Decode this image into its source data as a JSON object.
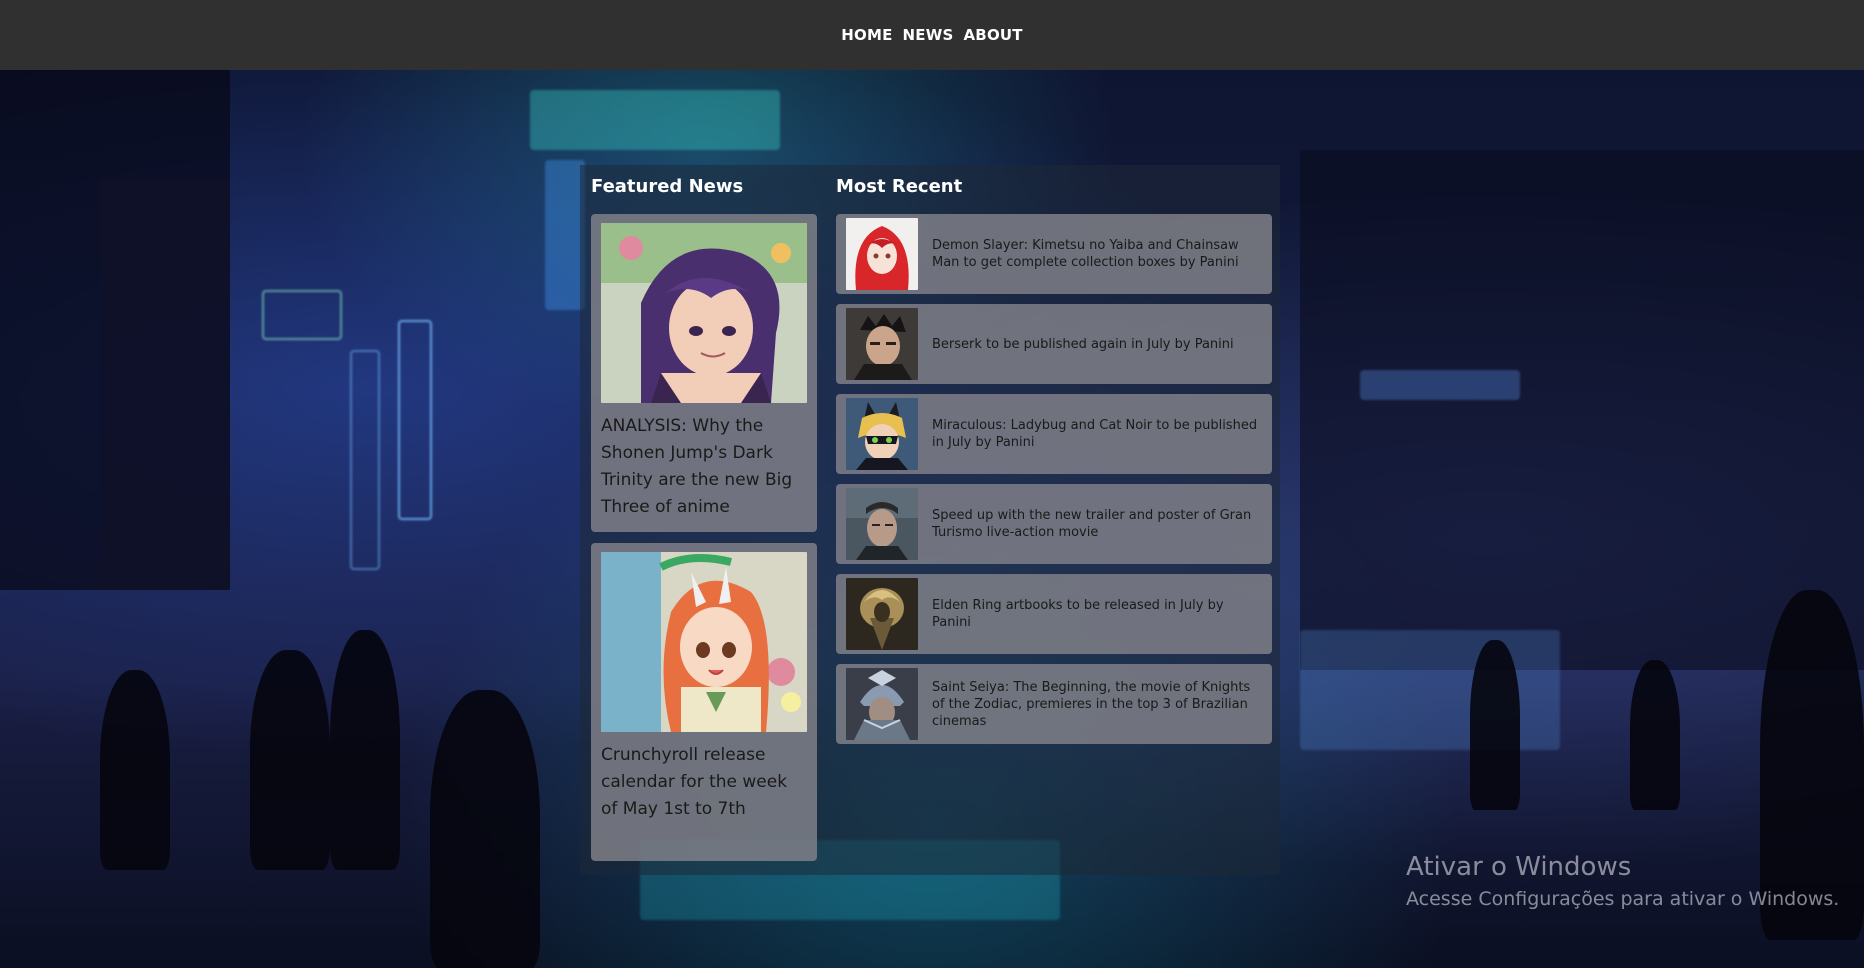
{
  "nav": {
    "items": [
      {
        "label": "HOME"
      },
      {
        "label": "NEWS"
      },
      {
        "label": "ABOUT"
      }
    ]
  },
  "featured": {
    "heading": "Featured News",
    "cards": [
      {
        "caption": "ANALYSIS: Why the Shonen Jump's Dark Trinity are the new Big Three of anime",
        "image": "anime-character-purple-hair-image"
      },
      {
        "caption": "Crunchyroll release calendar for the week of May 1st to 7th",
        "image": "anime-character-orange-hair-image"
      }
    ]
  },
  "recent": {
    "heading": "Most Recent",
    "items": [
      {
        "text": "Demon Slayer: Kimetsu no Yaiba and Chainsaw Man to get complete collection boxes by Panini",
        "image": "red-hair-character-image"
      },
      {
        "text": "Berserk to be published again in July by Panini",
        "image": "berserk-guts-image"
      },
      {
        "text": "Miraculous: Ladybug and Cat Noir to be published in July by Panini",
        "image": "cat-noir-image"
      },
      {
        "text": "Speed up with the new trailer and poster of Gran Turismo live-action movie",
        "image": "gran-turismo-actor-image"
      },
      {
        "text": "Elden Ring artbooks to be released in July by Panini",
        "image": "elden-ring-art-image"
      },
      {
        "text": "Saint Seiya: The Beginning, the movie of Knights of the Zodiac, premieres in the top 3 of Brazilian cinemas",
        "image": "saint-seiya-armor-image"
      }
    ]
  },
  "watermark": {
    "title": "Ativar o Windows",
    "subtitle": "Acesse Configurações para ativar o Windows."
  }
}
